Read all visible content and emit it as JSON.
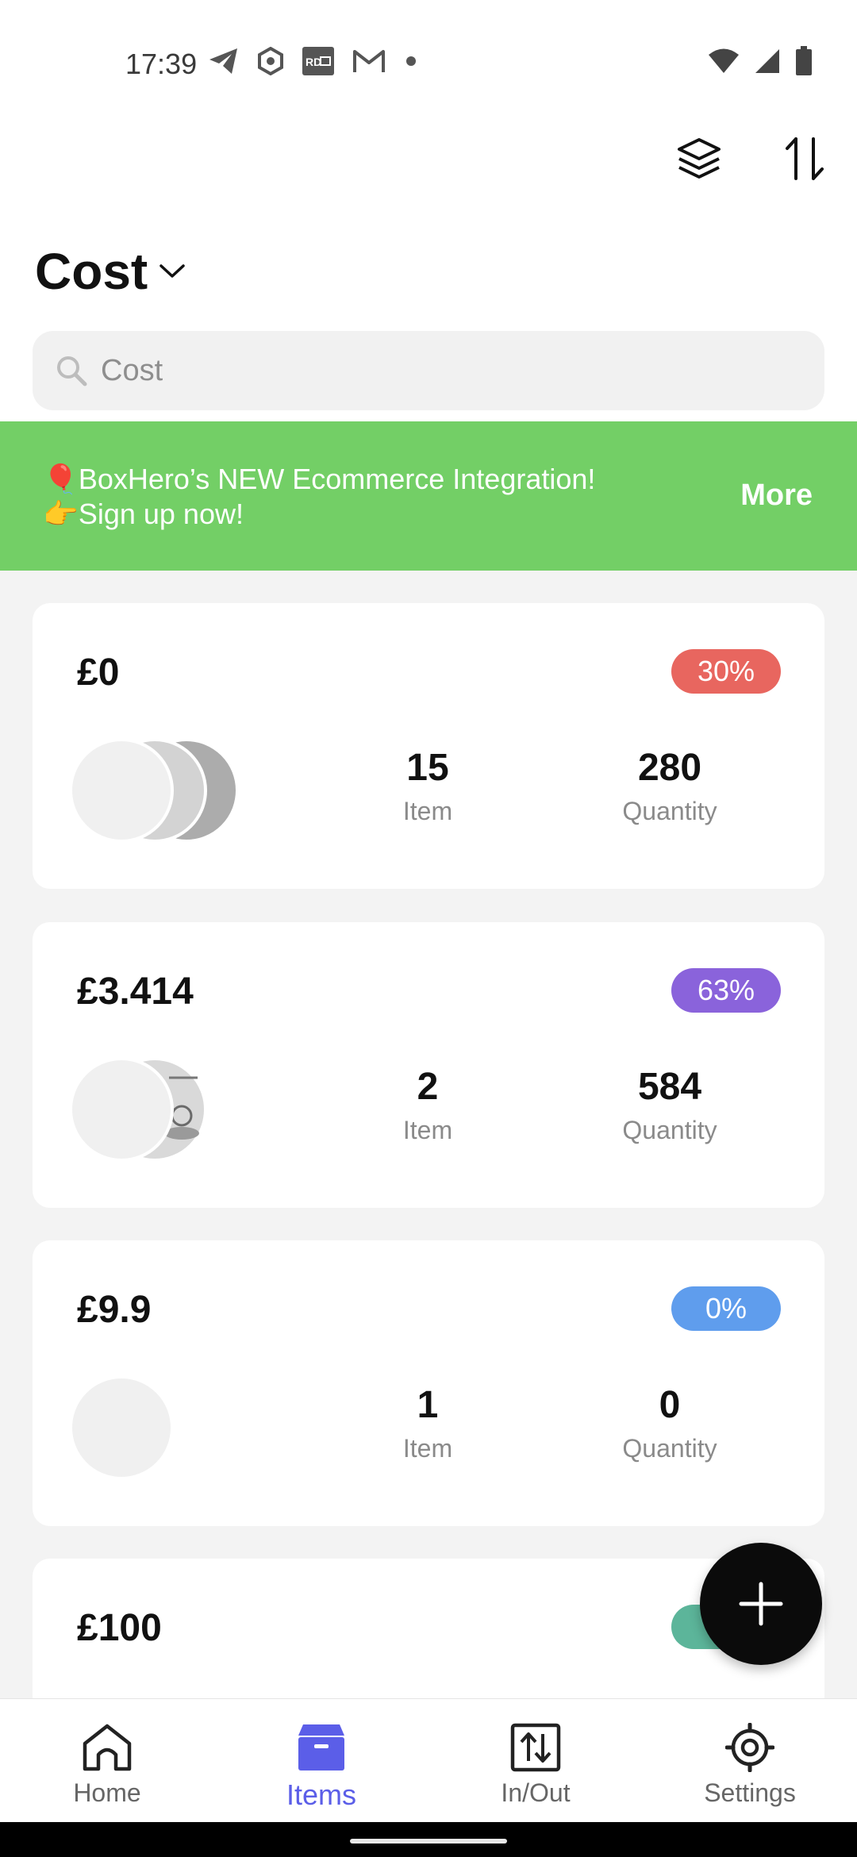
{
  "status_bar": {
    "time": "17:39",
    "left_icons": [
      "telegram-icon",
      "hexagon-app-icon",
      "rd-app-icon",
      "gmail-icon",
      "dot-icon"
    ],
    "right_icons": [
      "wifi-icon",
      "signal-icon",
      "battery-icon"
    ]
  },
  "header": {
    "actions": [
      "layers-icon",
      "sort-icon"
    ],
    "title": "Cost",
    "search_placeholder": "Cost"
  },
  "banner": {
    "line1": "🎈BoxHero’s NEW Ecommerce Integration!",
    "line2": "👉Sign up now!",
    "more_label": "More",
    "color": "#73cf66"
  },
  "groups": [
    {
      "price": "£0",
      "percent": "30%",
      "badge_color": "#e8665f",
      "items": "15",
      "items_label": "Item",
      "quantity": "280",
      "quantity_label": "Quantity"
    },
    {
      "price": "£3.414",
      "percent": "63%",
      "badge_color": "#8a63db",
      "items": "2",
      "items_label": "Item",
      "quantity": "584",
      "quantity_label": "Quantity"
    },
    {
      "price": "£9.9",
      "percent": "0%",
      "badge_color": "#5f9ded",
      "items": "1",
      "items_label": "Item",
      "quantity": "0",
      "quantity_label": "Quantity"
    },
    {
      "price": "£100",
      "percent": "",
      "badge_color": "#5cb59a"
    }
  ],
  "fab": {
    "icon": "plus-icon"
  },
  "bottom_nav": {
    "items": [
      {
        "label": "Home",
        "icon": "home-icon"
      },
      {
        "label": "Items",
        "icon": "box-icon",
        "active": true
      },
      {
        "label": "In/Out",
        "icon": "in-out-icon"
      },
      {
        "label": "Settings",
        "icon": "gear-icon"
      }
    ],
    "active_color": "#5b5ee8"
  }
}
